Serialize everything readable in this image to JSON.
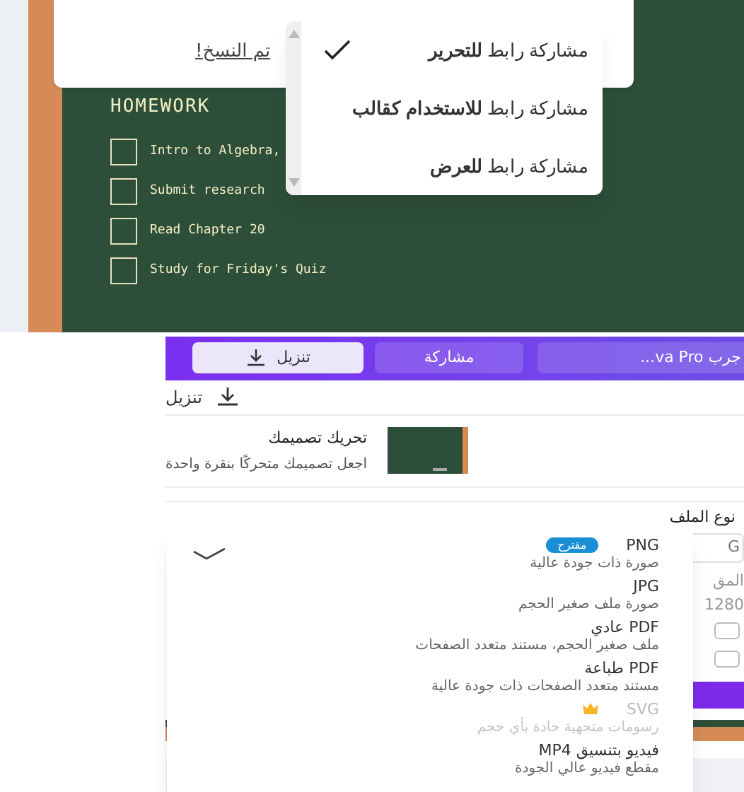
{
  "board": {
    "title": "HOMEWORK",
    "tasks": [
      {
        "label": "Intro to Algebra,",
        "checked": false
      },
      {
        "label": "Submit research",
        "checked": false
      },
      {
        "label": "Read Chapter 20",
        "checked": false
      },
      {
        "label": "Study for Friday's Quiz",
        "checked": false
      }
    ]
  },
  "copy_card": {
    "link": "تم النسخ!"
  },
  "share_menu": {
    "items": [
      {
        "label": "مشاركة رابط **للتحرير**",
        "selected": true
      },
      {
        "label": "مشاركة رابط **للاستخدام كقالب**",
        "selected": false
      },
      {
        "label": "مشاركة رابط **للعرض**",
        "selected": false
      }
    ]
  },
  "toolbar": {
    "buttons": [
      {
        "label": "جرب va Pro...",
        "kind": "pro"
      },
      {
        "label": "مشاركة",
        "kind": "share"
      },
      {
        "label": "تنزيل",
        "kind": "download"
      }
    ]
  },
  "download_panel": {
    "header": "تنزيل",
    "motion": {
      "title": "تحريك تصميمك",
      "subtitle": "اجعل تصميمك متحركًا بنقرة واحدة"
    },
    "file_type_label": "نوع الملف",
    "file_type_value": "G",
    "size_label": "المق",
    "size_value": "1280",
    "options": [
      {
        "checked": false
      },
      {
        "checked": false
      }
    ]
  },
  "format_menu": {
    "items": [
      {
        "title": "PNG",
        "badge": "مقترح",
        "description": "صورة ذات جودة عالية",
        "selected": true,
        "disabled": false,
        "premium": false
      },
      {
        "title": "JPG",
        "description": "صورة ملف صغير الحجم",
        "selected": false,
        "disabled": false,
        "premium": false
      },
      {
        "title": "PDF عادي",
        "description": "ملف صغير الحجم، مستند متعدد الصفحات",
        "selected": false,
        "disabled": false,
        "premium": false
      },
      {
        "title": "PDF طباعة",
        "description": "مستند متعدد الصفحات ذات جودة عالية",
        "selected": false,
        "disabled": false,
        "premium": false
      },
      {
        "title": "SVG",
        "description": "رسومات متجهية حادة بأي حجم",
        "selected": false,
        "disabled": true,
        "premium": true
      },
      {
        "title": "فيديو بتنسيق MP4",
        "description": "مقطع فيديو عالي الجودة",
        "selected": false,
        "disabled": false,
        "premium": false
      }
    ]
  }
}
